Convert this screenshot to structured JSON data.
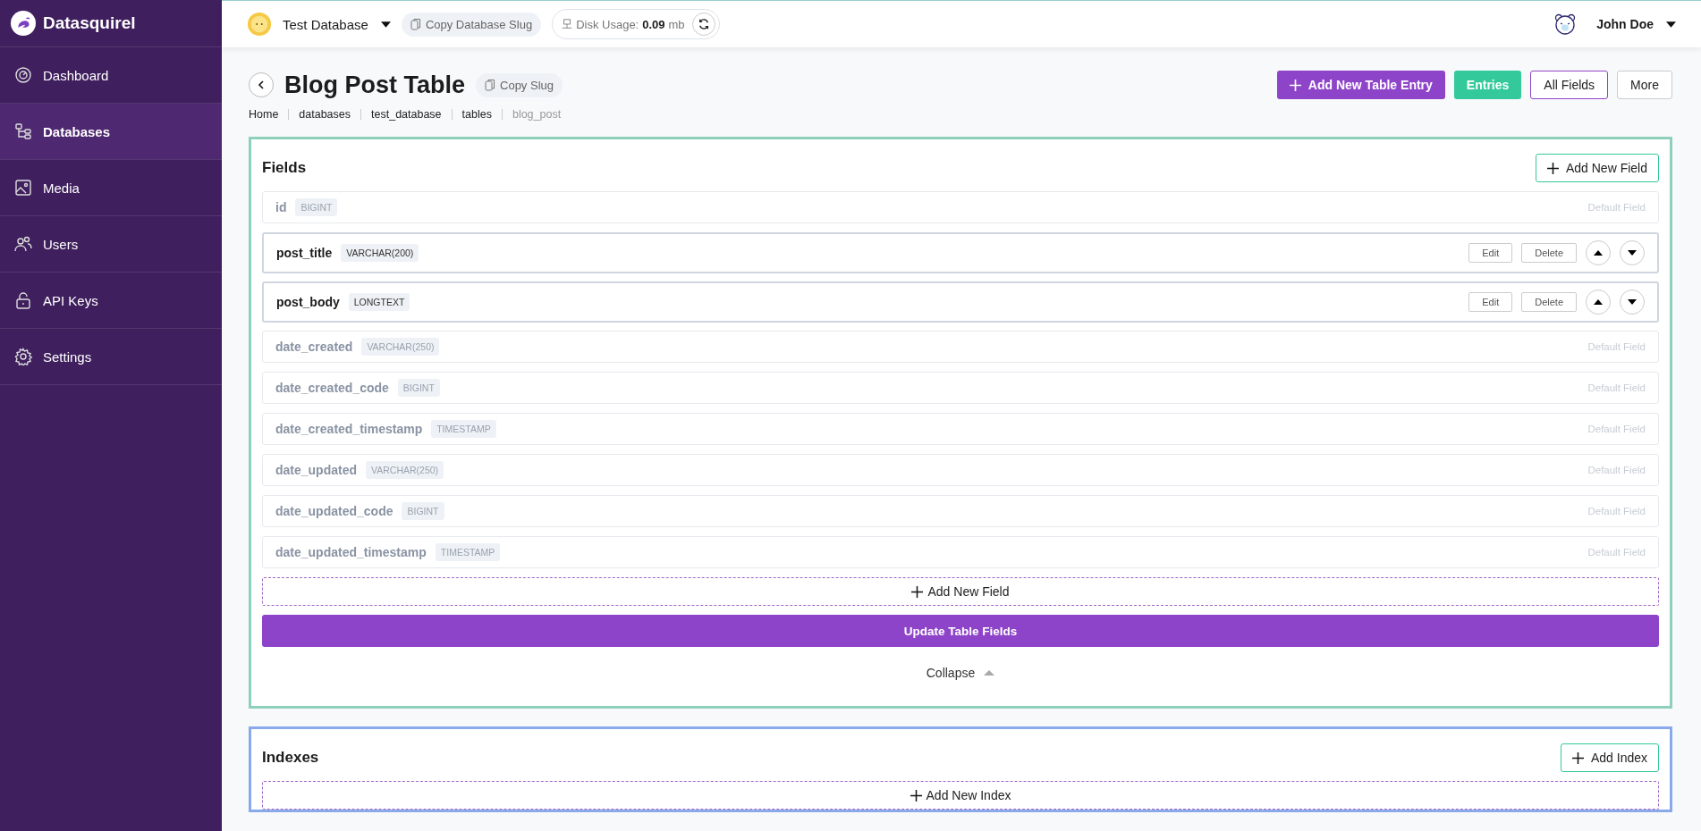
{
  "brand": {
    "name": "Datasquirel"
  },
  "sidebar": {
    "items": [
      {
        "label": "Dashboard",
        "selected": false
      },
      {
        "label": "Databases",
        "selected": true
      },
      {
        "label": "Media",
        "selected": false
      },
      {
        "label": "Users",
        "selected": false
      },
      {
        "label": "API Keys",
        "selected": false
      },
      {
        "label": "Settings",
        "selected": false
      }
    ]
  },
  "topbar": {
    "database": "Test Database",
    "copy_slug": "Copy Database Slug",
    "disk_label": "Disk Usage:",
    "disk_value": "0.09",
    "disk_unit": "mb",
    "user": "John Doe"
  },
  "page": {
    "title": "Blog Post Table",
    "copy_slug": "Copy Slug",
    "breadcrumbs": [
      {
        "label": "Home",
        "current": false
      },
      {
        "label": "databases",
        "current": false
      },
      {
        "label": "test_database",
        "current": false
      },
      {
        "label": "tables",
        "current": false
      },
      {
        "label": "blog_post",
        "current": true
      }
    ],
    "actions": [
      {
        "label": "Add New Table Entry",
        "kind": "primary"
      },
      {
        "label": "Entries",
        "kind": "success"
      },
      {
        "label": "All Fields",
        "kind": "outline"
      },
      {
        "label": "More",
        "kind": "plain"
      }
    ]
  },
  "fields_card": {
    "title": "Fields",
    "add_button": "Add New Field",
    "fields": [
      {
        "name": "id",
        "type": "BIGINT",
        "kind": "default",
        "note": "Default Field"
      },
      {
        "name": "post_title",
        "type": "VARCHAR(200)",
        "kind": "custom",
        "edit": "Edit",
        "delete": "Delete"
      },
      {
        "name": "post_body",
        "type": "LONGTEXT",
        "kind": "custom",
        "edit": "Edit",
        "delete": "Delete"
      },
      {
        "name": "date_created",
        "type": "VARCHAR(250)",
        "kind": "default",
        "note": "Default Field"
      },
      {
        "name": "date_created_code",
        "type": "BIGINT",
        "kind": "default",
        "note": "Default Field"
      },
      {
        "name": "date_created_timestamp",
        "type": "TIMESTAMP",
        "kind": "default",
        "note": "Default Field"
      },
      {
        "name": "date_updated",
        "type": "VARCHAR(250)",
        "kind": "default",
        "note": "Default Field"
      },
      {
        "name": "date_updated_code",
        "type": "BIGINT",
        "kind": "default",
        "note": "Default Field"
      },
      {
        "name": "date_updated_timestamp",
        "type": "TIMESTAMP",
        "kind": "default",
        "note": "Default Field"
      }
    ],
    "add_field_row": "Add New Field",
    "update_button": "Update Table Fields",
    "collapse": "Collapse"
  },
  "indexes_card": {
    "title": "Indexes",
    "add_button": "Add Index",
    "add_index_row": "Add New Index"
  }
}
